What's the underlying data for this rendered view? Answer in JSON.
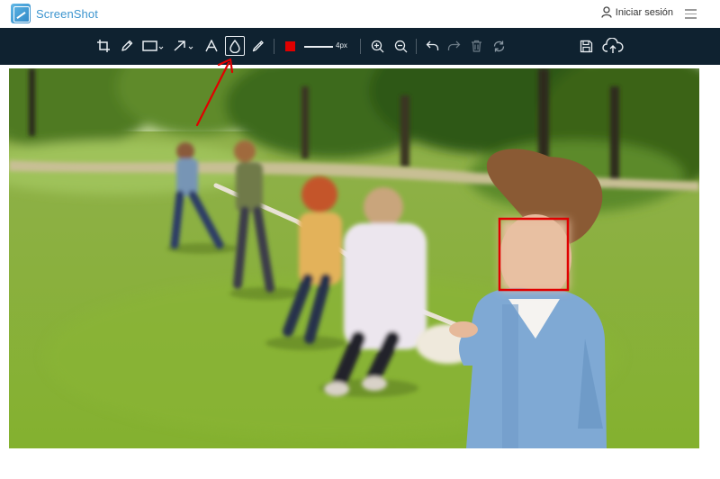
{
  "app": {
    "name": "ScreenShot"
  },
  "header": {
    "login_label": "Iniciar sesión"
  },
  "toolbar": {
    "line_width_label": "4px",
    "active_tool": "blur",
    "tools": [
      "crop-icon",
      "pencil-icon",
      "rectangle-icon",
      "arrow-icon",
      "text-icon",
      "blur-icon",
      "marker-icon",
      "color-swatch",
      "line-width",
      "zoom-in-icon",
      "zoom-out-icon",
      "undo-icon",
      "redo-icon",
      "trash-icon",
      "reset-icon",
      "save-icon",
      "upload-cloud-icon"
    ],
    "annotation_color": "#e00000"
  },
  "colors": {
    "toolbar_bg": "#0f2230",
    "brand": "#3d95cf",
    "annotation_red": "#e00000"
  }
}
